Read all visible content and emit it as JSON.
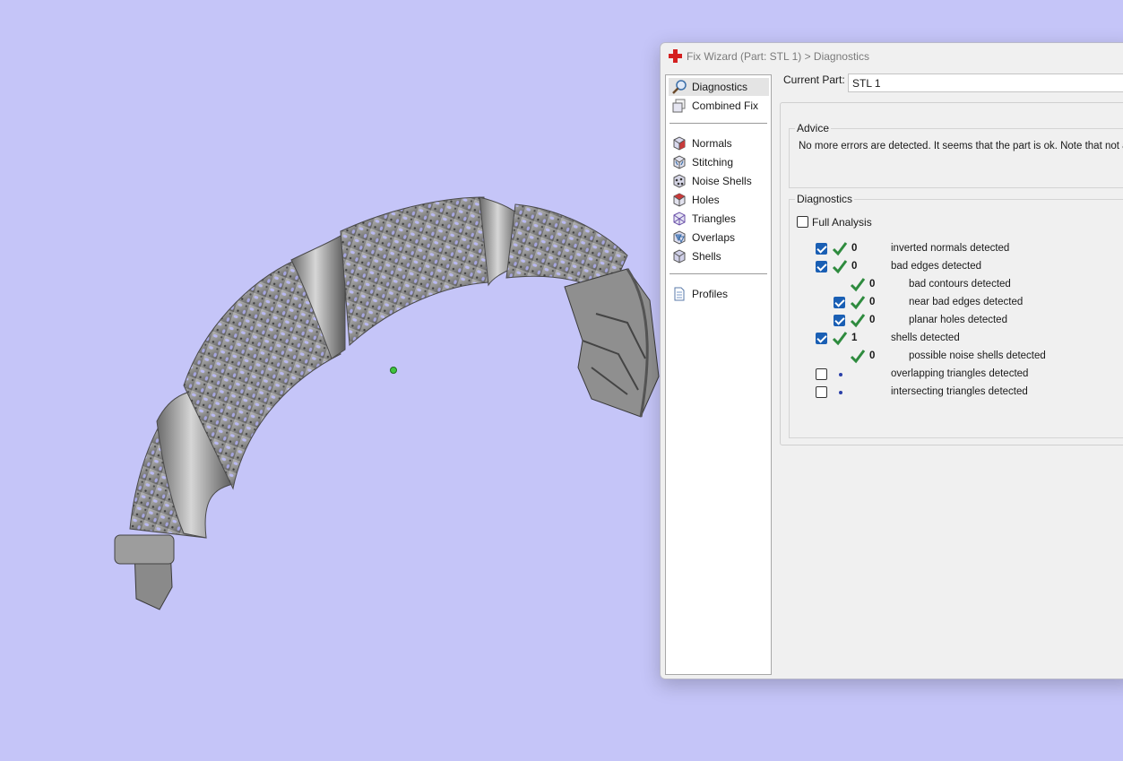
{
  "window": {
    "title": "Fix Wizard (Part: STL 1) > Diagnostics"
  },
  "nav": {
    "items": [
      {
        "label": "Diagnostics",
        "icon": "magnifier-icon",
        "selected": true
      },
      {
        "label": "Combined Fix",
        "icon": "stacked-cubes-icon"
      },
      {
        "label": "Normals",
        "icon": "normals-cube-icon"
      },
      {
        "label": "Stitching",
        "icon": "stitching-cube-icon"
      },
      {
        "label": "Noise Shells",
        "icon": "noise-shells-icon"
      },
      {
        "label": "Holes",
        "icon": "holes-cube-icon"
      },
      {
        "label": "Triangles",
        "icon": "triangles-cube-icon"
      },
      {
        "label": "Overlaps",
        "icon": "overlaps-icon"
      },
      {
        "label": "Shells",
        "icon": "shells-cube-icon"
      },
      {
        "label": "Profiles",
        "icon": "document-icon"
      }
    ]
  },
  "current_part": {
    "label": "Current Part:",
    "value": "STL 1"
  },
  "advice": {
    "caption": "Advice",
    "text": "No more errors are detected. It seems that the part is ok. Note that not all"
  },
  "diagnostics": {
    "caption": "Diagnostics",
    "full_analysis_label": "Full Analysis",
    "full_analysis_checked": false,
    "rows": [
      {
        "count": "0",
        "label": "inverted normals detected",
        "checked": true,
        "status": "ok"
      },
      {
        "count": "0",
        "label": "bad edges detected",
        "checked": true,
        "status": "ok"
      },
      {
        "count": "0",
        "label": "bad contours detected",
        "status": "ok"
      },
      {
        "count": "0",
        "label": "near bad edges detected",
        "checked": true,
        "status": "ok"
      },
      {
        "count": "0",
        "label": "planar holes detected",
        "checked": true,
        "status": "ok"
      },
      {
        "count": "1",
        "label": "shells detected",
        "checked": true,
        "status": "ok"
      },
      {
        "count": "0",
        "label": "possible noise shells detected",
        "status": "ok"
      },
      {
        "count": "",
        "label": "overlapping triangles detected",
        "checked": false,
        "status": "pending"
      },
      {
        "count": "",
        "label": "intersecting triangles detected",
        "checked": false,
        "status": "pending"
      }
    ]
  },
  "colors": {
    "viewport_background": "#c5c5f8",
    "model_gray": "#8c8c8c",
    "check_green": "#2e8b3e",
    "checkbox_blue": "#1a5fb4",
    "app_icon_red": "#d42020"
  }
}
